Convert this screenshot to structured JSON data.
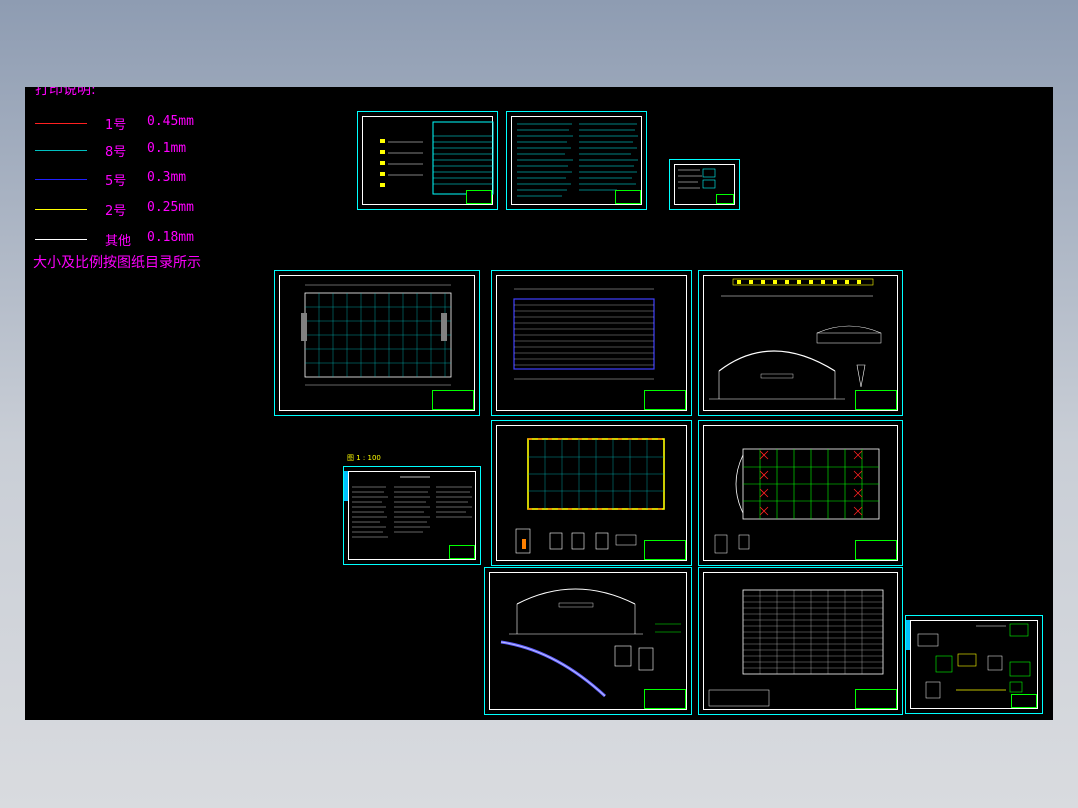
{
  "legend": {
    "title": "打印说明:",
    "rows": [
      {
        "color": "#ff2020",
        "number": "1号",
        "width": "0.45mm"
      },
      {
        "color": "#00c0c0",
        "number": "8号",
        "width": "0.1mm"
      },
      {
        "color": "#2020ff",
        "number": "5号",
        "width": "0.3mm"
      },
      {
        "color": "#ffff00",
        "number": "2号",
        "width": "0.25mm"
      },
      {
        "color": "#ffffff",
        "number": "其他",
        "width": "0.18mm"
      }
    ],
    "note": "大小及比例按图纸目录所示"
  },
  "sheets_label": "图 1 : 100",
  "colors": {
    "background_top": "#8e9cb2",
    "canvas": "#000000",
    "frame": "#00ffff",
    "legend_text": "#ff00ff"
  }
}
